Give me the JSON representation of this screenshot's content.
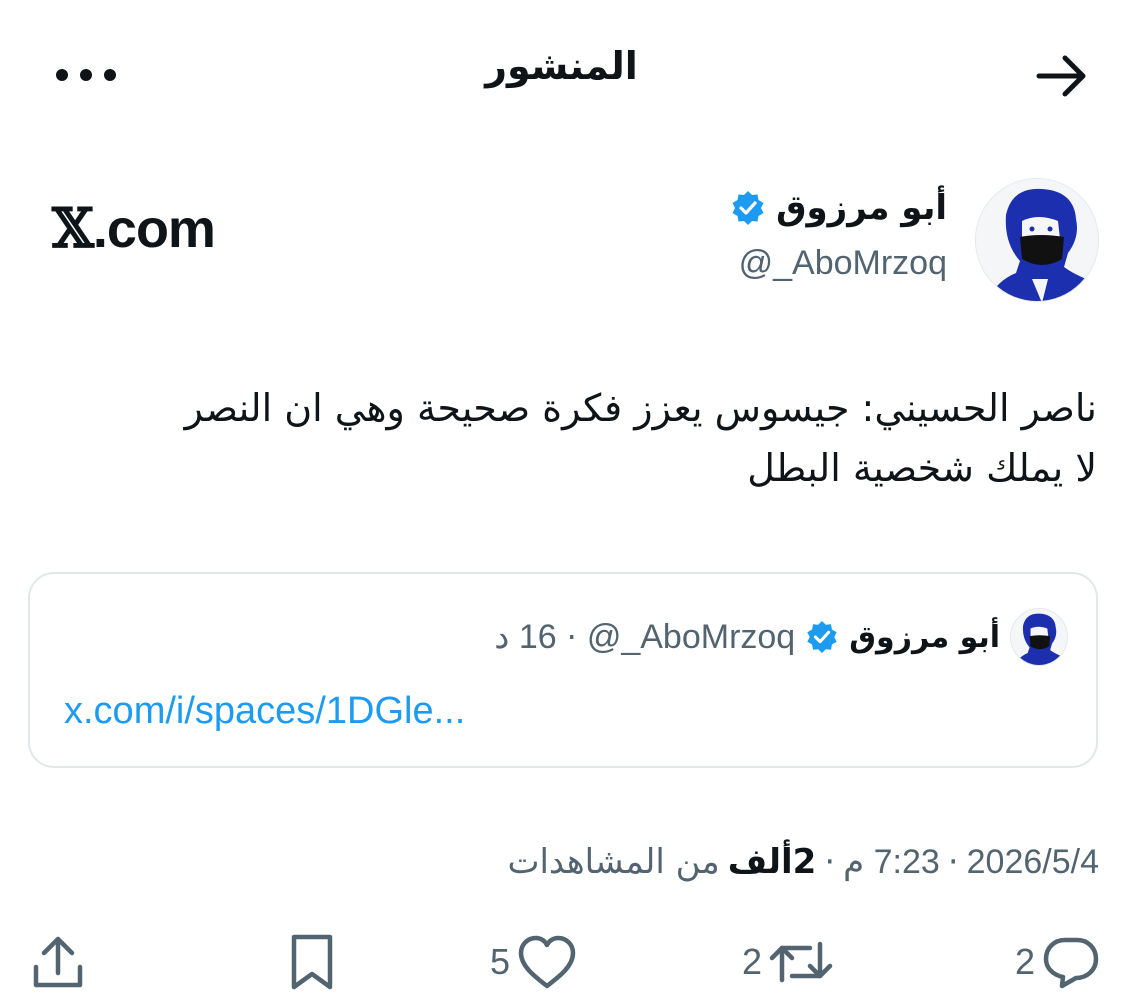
{
  "header": {
    "title": "المنشور"
  },
  "author": {
    "name": "أبو مرزوق",
    "handle": "@_AboMrzoq",
    "verified": true
  },
  "brand": {
    "logo_glyph": "𝕏",
    "text": ".com"
  },
  "tweet": {
    "line1": "ناصر الحسيني: جيسوس يعزز فكرة صحيحة وهي ان النصر",
    "line2": "لا يملك شخصية البطل"
  },
  "quote": {
    "name": "أبو مرزوق",
    "handle": "@_AboMrzoq",
    "separator": "·",
    "time": "16 د",
    "link": "x.com/i/spaces/1DGle..."
  },
  "meta": {
    "date": "2026/5/4",
    "sep1": "·",
    "time": "7:23 م",
    "sep2": "·",
    "views": "2ألف",
    "views_suffix": "من المشاهدات"
  },
  "actions": {
    "reply_count": "2",
    "retweet_count": "2",
    "like_count": "5"
  },
  "colors": {
    "accent": "#1d9bf0",
    "text": "#0f1419",
    "muted": "#536471",
    "border": "#e3e7ea",
    "avatar_ink": "#1c2fae"
  },
  "icons": [
    "back-arrow-icon",
    "more-icon",
    "verified-badge-icon",
    "reply-icon",
    "retweet-icon",
    "like-icon",
    "bookmark-icon",
    "share-icon"
  ]
}
